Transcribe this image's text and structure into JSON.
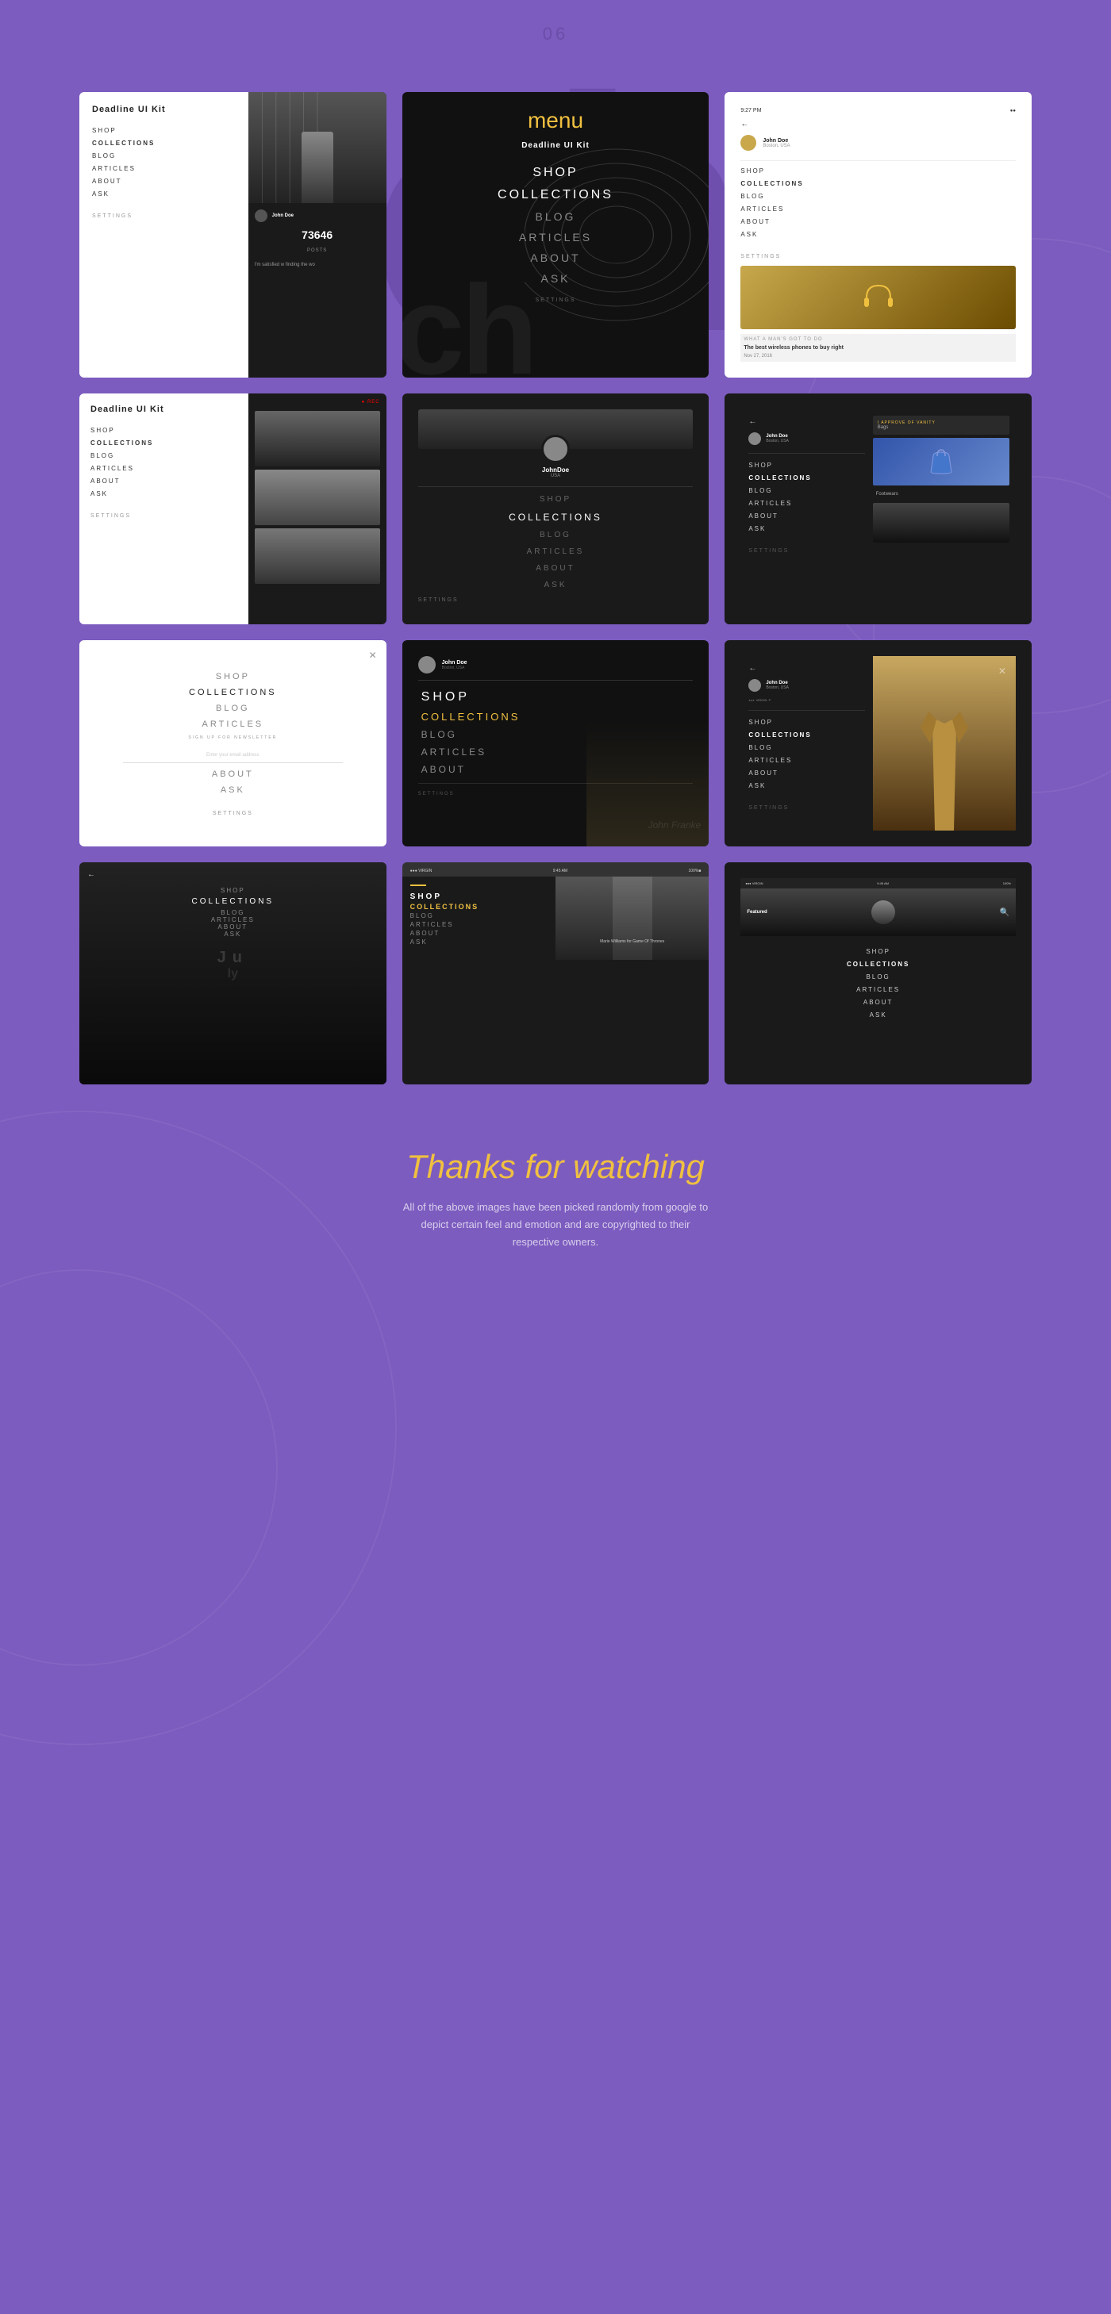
{
  "page": {
    "number": "06",
    "bg_text": "ch",
    "footer": {
      "title": "Thanks for watching",
      "text": "All of the above images have been picked randomly from google to depict certain feel and emotion and are copyrighted to their respective owners."
    }
  },
  "nav_items": {
    "shop": "SHOP",
    "collections": "COLLECTIONS",
    "blog": "BLOG",
    "articles": "ARTICLES",
    "about": "ABOUT",
    "ask": "ASK",
    "settings": "SETTINGS"
  },
  "brand": "Deadline UI Kit",
  "menu_label": "menu",
  "cards": [
    {
      "id": "card-1",
      "theme": "white-split",
      "description": "White nav + person photo"
    },
    {
      "id": "card-2",
      "theme": "dark-menu",
      "description": "Dark menu full"
    },
    {
      "id": "card-3",
      "theme": "white-phone-headphones",
      "description": "Phone white nav + headphones"
    },
    {
      "id": "card-4",
      "theme": "white-nav-photo",
      "description": "White nav + portrait photo"
    },
    {
      "id": "card-5",
      "theme": "dark-profile",
      "description": "Dark profile centered"
    },
    {
      "id": "card-6",
      "theme": "dark-phone-bags",
      "description": "Dark nav phone + bags"
    },
    {
      "id": "card-7",
      "theme": "white-close-nav",
      "description": "White nav with close btn"
    },
    {
      "id": "card-8",
      "theme": "dark-large-nav",
      "description": "Dark large nav items"
    },
    {
      "id": "card-9",
      "theme": "dark-phone-coat",
      "description": "Dark nav + coat photo"
    },
    {
      "id": "card-10",
      "theme": "dark-overlay-nav",
      "description": "Dark nav overlay"
    },
    {
      "id": "card-11",
      "theme": "dark-shop-list",
      "description": "Dark shop list"
    },
    {
      "id": "card-12",
      "theme": "dark-featured",
      "description": "Dark featured nav"
    }
  ],
  "profile": {
    "name": "John Doe",
    "location": "Boston, USA",
    "count": "73646",
    "count_label": "Posts"
  },
  "article": {
    "title": "The best wireless phones to buy right",
    "tag": "WHAT A MAN'S GOT TO DO",
    "date": "Nov 27, 2016"
  },
  "article2": {
    "title": "I APPROVE OF VANITY",
    "subtitle": "Bags"
  },
  "article3": {
    "title": "Footwears"
  },
  "snippet": "I'm satisfied w finding the wo",
  "person_name": "JohnDoe",
  "person_loc": "USA",
  "shop_list": {
    "items": [
      "SHOP",
      "COLLECTIONS",
      "BLOG",
      "ARTICLES",
      "ABOUT",
      "ASK"
    ]
  },
  "featured": {
    "label": "Featured",
    "person": "Marie Williams for Game Of Thrones"
  },
  "colors": {
    "purple_bg": "#7c5cbf",
    "yellow": "#f0c040",
    "dark": "#111111",
    "dark2": "#1a1a1a",
    "white": "#ffffff"
  }
}
